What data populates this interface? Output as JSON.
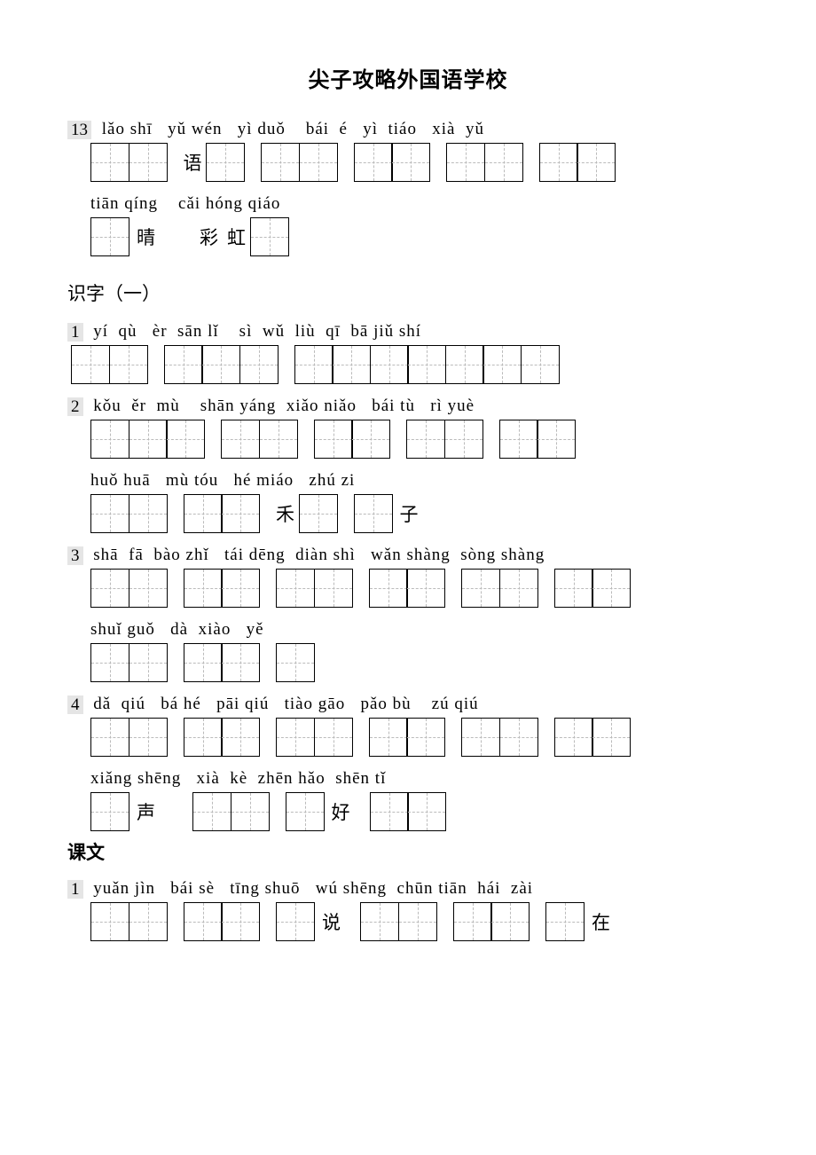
{
  "title": "尖子攻略外国语学校",
  "sections": {
    "shizi": "识字（一）",
    "kewen": "课文"
  },
  "lines": {
    "l13a_num": "13",
    "l13a_py": " lǎo shī   yǔ wén   yì duǒ    bái  é   yì  tiáo   xià  yǔ",
    "l13a_txt_yu": "语",
    "l13b_py": "tiān qíng    cǎi hóng qiáo",
    "l13b_txt_qing": "晴",
    "l13b_txt_cai": "彩",
    "l13b_txt_hong": "虹",
    "s1_num": "1",
    "s1_py": " yí  qù   èr  sān lǐ    sì  wǔ  liù  qī  bā jiǔ shí",
    "s2_num": "2",
    "s2a_py": " kǒu  ěr  mù    shān yáng  xiǎo niǎo   bái tù   rì yuè",
    "s2b_py": "huǒ huā   mù tóu   hé miáo   zhú zi",
    "s2b_txt_he": "禾",
    "s2b_txt_zi": "子",
    "s3_num": "3",
    "s3a_py": " shā  fā  bào zhǐ   tái dēng  diàn shì   wǎn shàng  sòng shàng",
    "s3b_py": "shuǐ guǒ   dà  xiào   yě",
    "s4_num": "4",
    "s4a_py": " dǎ  qiú   bá hé   pāi qiú   tiào gāo   pǎo bù    zú qiú",
    "s4b_py": "xiǎng shēng   xià  kè  zhēn hǎo  shēn tǐ",
    "s4b_txt_sheng": "声",
    "s4b_txt_hao": "好",
    "k1_num": "1",
    "k1_py": " yuǎn jìn   bái sè   tīng shuō   wú shēng  chūn tiān  hái  zài",
    "k1_txt_shuo": "说",
    "k1_txt_zai": "在"
  }
}
